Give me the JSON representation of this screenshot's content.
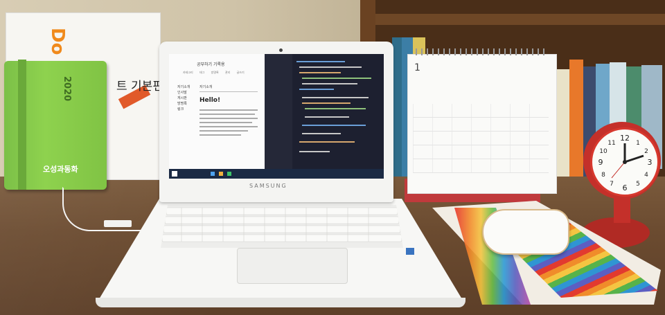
{
  "scene": {
    "doit_book": {
      "logo": "Do it!",
      "title": "트 기본편"
    },
    "green_notebook": {
      "year": "2020",
      "brand": "오성과동화"
    },
    "laptop": {
      "brand": "SAMSUNG",
      "screen": {
        "blog_title": "공부하기 기록용",
        "nav": [
          "카테고리",
          "태그",
          "방명록",
          "관리",
          "글쓰기"
        ],
        "sidebar": [
          "자기소개",
          "인사말",
          "게시판",
          "방명록",
          "링크"
        ],
        "section": "자기소개",
        "heading": "Hello!"
      }
    },
    "calendar": {
      "month": "1"
    },
    "colors": {
      "wall": "#d8cdb4",
      "shelf": "#4a2e18",
      "desk": "#6b4b30",
      "clock": "#c4302a",
      "notebook": "#8ed24e",
      "calendar_stand": "#c03a3c"
    }
  }
}
